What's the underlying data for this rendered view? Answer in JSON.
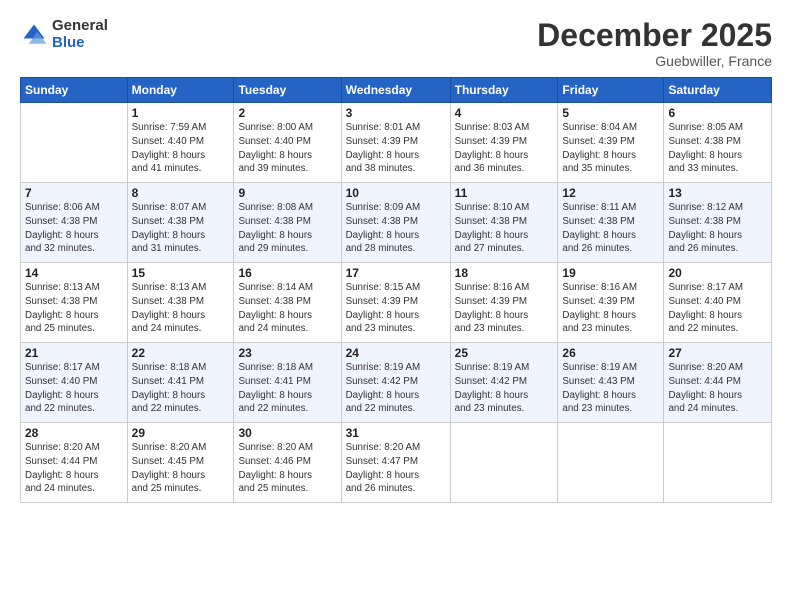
{
  "logo": {
    "general": "General",
    "blue": "Blue"
  },
  "title": "December 2025",
  "location": "Guebwiller, France",
  "days_header": [
    "Sunday",
    "Monday",
    "Tuesday",
    "Wednesday",
    "Thursday",
    "Friday",
    "Saturday"
  ],
  "weeks": [
    [
      {
        "day": "",
        "info": ""
      },
      {
        "day": "1",
        "info": "Sunrise: 7:59 AM\nSunset: 4:40 PM\nDaylight: 8 hours\nand 41 minutes."
      },
      {
        "day": "2",
        "info": "Sunrise: 8:00 AM\nSunset: 4:40 PM\nDaylight: 8 hours\nand 39 minutes."
      },
      {
        "day": "3",
        "info": "Sunrise: 8:01 AM\nSunset: 4:39 PM\nDaylight: 8 hours\nand 38 minutes."
      },
      {
        "day": "4",
        "info": "Sunrise: 8:03 AM\nSunset: 4:39 PM\nDaylight: 8 hours\nand 36 minutes."
      },
      {
        "day": "5",
        "info": "Sunrise: 8:04 AM\nSunset: 4:39 PM\nDaylight: 8 hours\nand 35 minutes."
      },
      {
        "day": "6",
        "info": "Sunrise: 8:05 AM\nSunset: 4:38 PM\nDaylight: 8 hours\nand 33 minutes."
      }
    ],
    [
      {
        "day": "7",
        "info": "Sunrise: 8:06 AM\nSunset: 4:38 PM\nDaylight: 8 hours\nand 32 minutes."
      },
      {
        "day": "8",
        "info": "Sunrise: 8:07 AM\nSunset: 4:38 PM\nDaylight: 8 hours\nand 31 minutes."
      },
      {
        "day": "9",
        "info": "Sunrise: 8:08 AM\nSunset: 4:38 PM\nDaylight: 8 hours\nand 29 minutes."
      },
      {
        "day": "10",
        "info": "Sunrise: 8:09 AM\nSunset: 4:38 PM\nDaylight: 8 hours\nand 28 minutes."
      },
      {
        "day": "11",
        "info": "Sunrise: 8:10 AM\nSunset: 4:38 PM\nDaylight: 8 hours\nand 27 minutes."
      },
      {
        "day": "12",
        "info": "Sunrise: 8:11 AM\nSunset: 4:38 PM\nDaylight: 8 hours\nand 26 minutes."
      },
      {
        "day": "13",
        "info": "Sunrise: 8:12 AM\nSunset: 4:38 PM\nDaylight: 8 hours\nand 26 minutes."
      }
    ],
    [
      {
        "day": "14",
        "info": "Sunrise: 8:13 AM\nSunset: 4:38 PM\nDaylight: 8 hours\nand 25 minutes."
      },
      {
        "day": "15",
        "info": "Sunrise: 8:13 AM\nSunset: 4:38 PM\nDaylight: 8 hours\nand 24 minutes."
      },
      {
        "day": "16",
        "info": "Sunrise: 8:14 AM\nSunset: 4:38 PM\nDaylight: 8 hours\nand 24 minutes."
      },
      {
        "day": "17",
        "info": "Sunrise: 8:15 AM\nSunset: 4:39 PM\nDaylight: 8 hours\nand 23 minutes."
      },
      {
        "day": "18",
        "info": "Sunrise: 8:16 AM\nSunset: 4:39 PM\nDaylight: 8 hours\nand 23 minutes."
      },
      {
        "day": "19",
        "info": "Sunrise: 8:16 AM\nSunset: 4:39 PM\nDaylight: 8 hours\nand 23 minutes."
      },
      {
        "day": "20",
        "info": "Sunrise: 8:17 AM\nSunset: 4:40 PM\nDaylight: 8 hours\nand 22 minutes."
      }
    ],
    [
      {
        "day": "21",
        "info": "Sunrise: 8:17 AM\nSunset: 4:40 PM\nDaylight: 8 hours\nand 22 minutes."
      },
      {
        "day": "22",
        "info": "Sunrise: 8:18 AM\nSunset: 4:41 PM\nDaylight: 8 hours\nand 22 minutes."
      },
      {
        "day": "23",
        "info": "Sunrise: 8:18 AM\nSunset: 4:41 PM\nDaylight: 8 hours\nand 22 minutes."
      },
      {
        "day": "24",
        "info": "Sunrise: 8:19 AM\nSunset: 4:42 PM\nDaylight: 8 hours\nand 22 minutes."
      },
      {
        "day": "25",
        "info": "Sunrise: 8:19 AM\nSunset: 4:42 PM\nDaylight: 8 hours\nand 23 minutes."
      },
      {
        "day": "26",
        "info": "Sunrise: 8:19 AM\nSunset: 4:43 PM\nDaylight: 8 hours\nand 23 minutes."
      },
      {
        "day": "27",
        "info": "Sunrise: 8:20 AM\nSunset: 4:44 PM\nDaylight: 8 hours\nand 24 minutes."
      }
    ],
    [
      {
        "day": "28",
        "info": "Sunrise: 8:20 AM\nSunset: 4:44 PM\nDaylight: 8 hours\nand 24 minutes."
      },
      {
        "day": "29",
        "info": "Sunrise: 8:20 AM\nSunset: 4:45 PM\nDaylight: 8 hours\nand 25 minutes."
      },
      {
        "day": "30",
        "info": "Sunrise: 8:20 AM\nSunset: 4:46 PM\nDaylight: 8 hours\nand 25 minutes."
      },
      {
        "day": "31",
        "info": "Sunrise: 8:20 AM\nSunset: 4:47 PM\nDaylight: 8 hours\nand 26 minutes."
      },
      {
        "day": "",
        "info": ""
      },
      {
        "day": "",
        "info": ""
      },
      {
        "day": "",
        "info": ""
      }
    ]
  ],
  "colors": {
    "header_bg": "#2563c4",
    "header_text": "#ffffff",
    "alt_row": "#f0f3ff"
  }
}
